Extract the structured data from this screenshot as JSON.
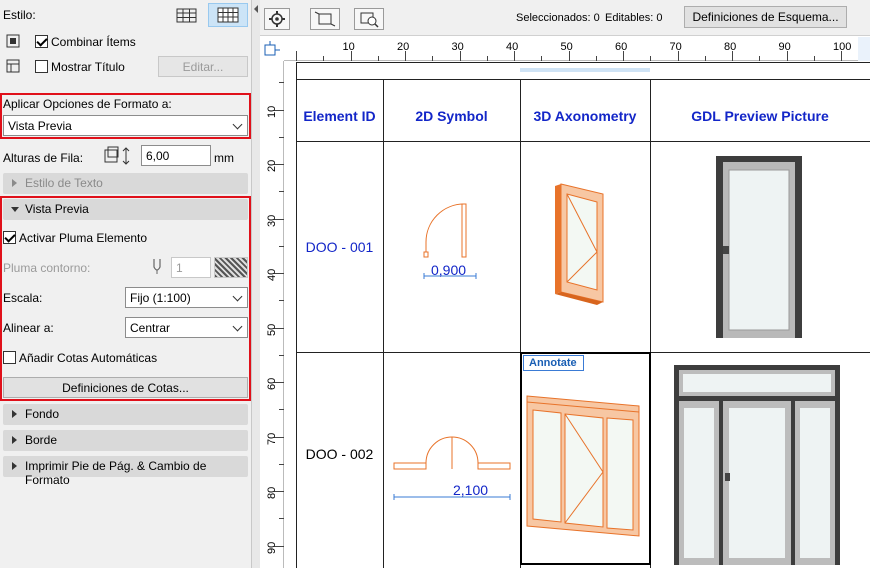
{
  "left_panel": {
    "estilo_label": "Estilo:",
    "combinar_label": "Combinar Ítems",
    "combinar_checked": true,
    "mostrar_titulo_label": "Mostrar Título",
    "mostrar_titulo_checked": false,
    "editar_button": "Editar...",
    "aplicar_label": "Aplicar Opciones de Formato a:",
    "aplicar_value": "Vista Previa",
    "alturas_label": "Alturas de Fila:",
    "alturas_value": "6,00",
    "alturas_unit": "mm",
    "sections": {
      "estilo_texto": "Estilo de Texto",
      "vista_previa": "Vista Previa",
      "fondo": "Fondo",
      "borde": "Borde",
      "imprimir": "Imprimir Pie de Pág. & Cambio de Formato"
    },
    "activar_pluma_label": "Activar Pluma Elemento",
    "activar_pluma_checked": true,
    "pluma_contorno_label": "Pluma contorno:",
    "pluma_value": "1",
    "escala_label": "Escala:",
    "escala_value": "Fijo (1:100)",
    "alinear_label": "Alinear a:",
    "alinear_value": "Centrar",
    "cotas_auto_label": "Añadir Cotas Automáticas",
    "cotas_auto_checked": false,
    "definiciones_cotas_button": "Definiciones de Cotas..."
  },
  "toolbar": {
    "seleccionados": "Seleccionados: 0",
    "editables": "Editables: 0",
    "definiciones_esquema_button": "Definiciones de Esquema..."
  },
  "ruler": {
    "horizontal": [
      "10",
      "20",
      "30",
      "40",
      "50",
      "60",
      "70",
      "80",
      "90",
      "100"
    ],
    "vertical": [
      "10",
      "20",
      "30",
      "40",
      "50",
      "60",
      "70",
      "80",
      "90"
    ]
  },
  "schedule": {
    "headers": [
      "Element ID",
      "2D Symbol",
      "3D Axonometry",
      "GDL Preview Picture"
    ],
    "rows": [
      {
        "id": "DOO - 001",
        "dimension": "0,900"
      },
      {
        "id": "DOO - 002",
        "dimension": "2,100"
      }
    ],
    "annotate_tag": "Annotate"
  },
  "colors": {
    "highlight_red": "#e0101a",
    "header_blue": "#1326c8",
    "door_orange": "#e8732a"
  }
}
